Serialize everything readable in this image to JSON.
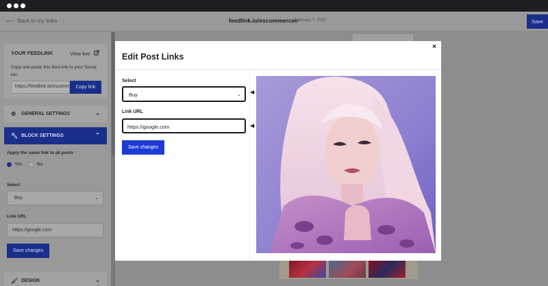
{
  "topnav": {
    "back_label": "Back to my links",
    "site_title": "feedlink.io/escommercee",
    "date": "February 7, 2022",
    "save_label": "Save"
  },
  "sidebar": {
    "feed_card": {
      "title": "YOUR FEEDLINK",
      "view_live": "View live",
      "description": "Copy and paste this feed link to your Social bio.",
      "link_value": "https://feedlink.io/escommercee",
      "copy_label": "Copy link"
    },
    "sections": {
      "general": "GENERAL SETTINGS",
      "block": "BLOCK SETTINGS",
      "design": "DESIGN"
    },
    "apply_label": "Apply the same link to all posts",
    "radio_yes": "Yes",
    "radio_no": "No",
    "select_label": "Select",
    "select_value": "Buy",
    "link_url_label": "Link URL",
    "link_url_value": "https://google.com",
    "save_label": "Save changes"
  },
  "modal": {
    "title": "Edit Post Links",
    "close_label": "×",
    "select_label": "Select",
    "select_value": "Buy",
    "link_url_label": "Link URL",
    "link_url_value": "https://google.com",
    "save_label": "Save changes"
  },
  "colors": {
    "accent": "#1f3bd6",
    "accent_dimmed": "#1a2f8a",
    "overlay": "#8d8d8d",
    "titlebar": "#1f1f23"
  },
  "icons": {
    "back": "arrow-left-icon",
    "view_live": "external-link-icon",
    "general": "gear-icon",
    "block": "wrench-icon",
    "design": "brush-icon",
    "chevron": "chevron-icon",
    "close": "close-icon"
  }
}
